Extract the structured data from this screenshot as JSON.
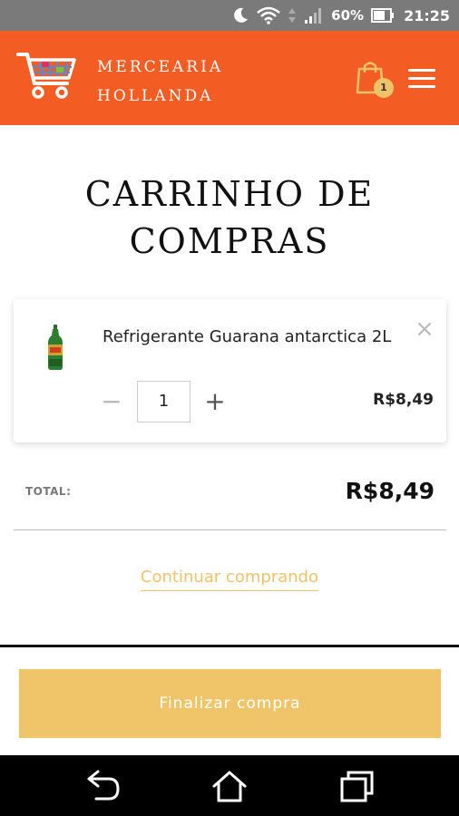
{
  "status_bar": {
    "battery_text": "60%",
    "time": "21:25",
    "icons": [
      "moon-icon",
      "wifi-icon",
      "signal-icon",
      "battery-icon"
    ]
  },
  "header": {
    "brand_line1": "MERCEARIA",
    "brand_line2": "HOLLANDA",
    "cart_count": "1",
    "accent_color": "#f35c23"
  },
  "page": {
    "title_line1": "CARRINHO DE",
    "title_line2": "COMPRAS"
  },
  "cart": {
    "items": [
      {
        "name": "Refrigerante Guarana antarctica 2L",
        "quantity": "1",
        "price": "R$8,49",
        "remove_symbol": "×",
        "minus_symbol": "−",
        "plus_symbol": "+"
      }
    ]
  },
  "summary": {
    "total_label": "TOTAL:",
    "total_value": "R$8,49",
    "continue_label": "Continuar comprando",
    "checkout_label": "Finalizar compra",
    "checkout_color": "#f0c468"
  },
  "nav": {
    "icons": [
      "back-icon",
      "home-icon",
      "recents-icon"
    ]
  }
}
